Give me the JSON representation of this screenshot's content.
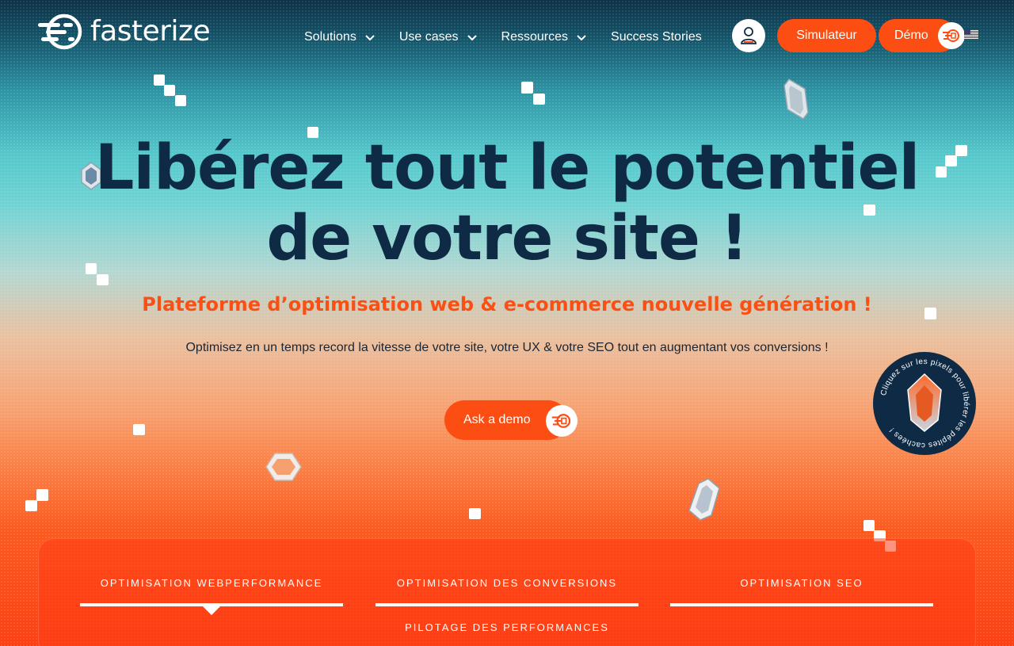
{
  "brand": {
    "name": "fasterize",
    "accent": "#fc4e13",
    "dark": "#0e2a45"
  },
  "nav": {
    "items": [
      {
        "label": "Solutions",
        "dropdown": true
      },
      {
        "label": "Use cases",
        "dropdown": true
      },
      {
        "label": "Ressources",
        "dropdown": true
      },
      {
        "label": "Success Stories",
        "dropdown": false
      }
    ],
    "user_icon": "user-icon",
    "simulator_label": "Simulateur",
    "demo_label": "Démo",
    "language_icon": "us-flag-icon"
  },
  "hero": {
    "title_line1": "Libérez tout le potentiel",
    "title_line2": "de votre site !",
    "subtitle": "Plateforme d’optimisation web & e-commerce nouvelle génération !",
    "description": "Optimisez en un temps record la vitesse de votre site, votre UX & votre SEO tout en augmentant vos conversions !",
    "cta_label": "Ask a demo"
  },
  "easter_egg_badge": {
    "text": "Cliquez sur les pixels pour libérer les pépites cachées !"
  },
  "tabs": [
    {
      "label": "OPTIMISATION WEBPERFORMANCE",
      "active": true
    },
    {
      "label": "OPTIMISATION DES CONVERSIONS",
      "active": false
    },
    {
      "label": "OPTIMISATION SEO",
      "active": false
    },
    {
      "label": "PILOTAGE DES PERFORMANCES",
      "active": false
    }
  ]
}
